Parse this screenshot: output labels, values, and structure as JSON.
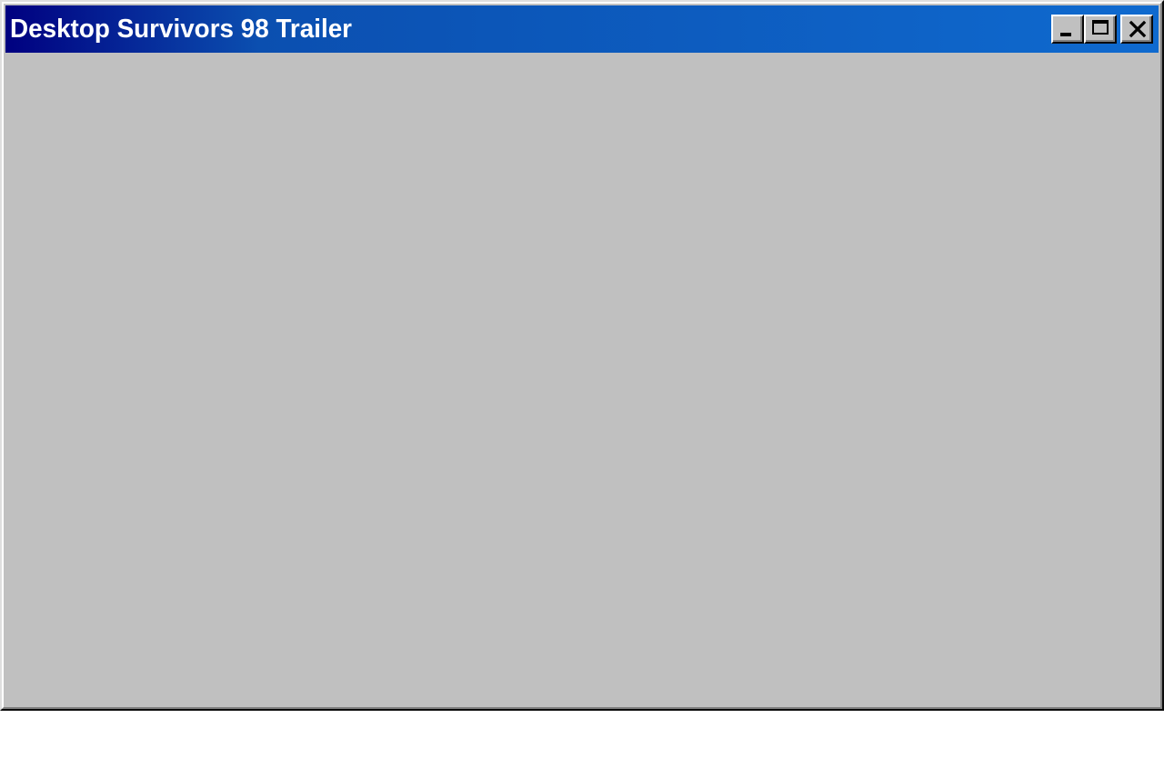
{
  "window": {
    "title": "Desktop Survivors 98 Trailer",
    "controls": {
      "minimize_icon": "minimize-icon",
      "maximize_icon": "maximize-icon",
      "close_icon": "close-icon"
    }
  },
  "colors": {
    "titlebar_start": "#000080",
    "titlebar_end": "#0f6acf",
    "window_face": "#c0c0c0",
    "title_text": "#ffffff"
  }
}
